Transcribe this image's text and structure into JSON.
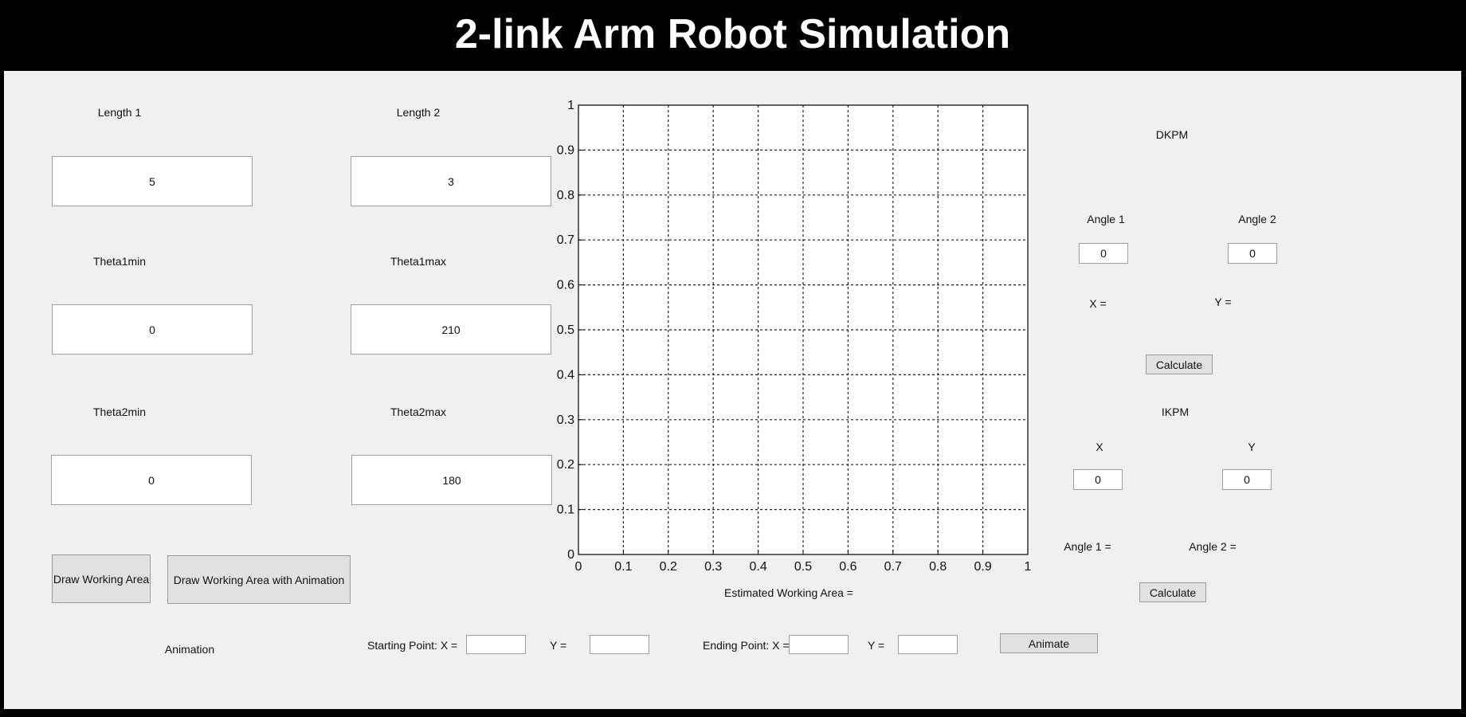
{
  "title": "2-link Arm Robot Simulation",
  "params": {
    "length1": {
      "label": "Length 1",
      "value": "5"
    },
    "length2": {
      "label": "Length 2",
      "value": "3"
    },
    "theta1min": {
      "label": "Theta1min",
      "value": "0"
    },
    "theta1max": {
      "label": "Theta1max",
      "value": "210"
    },
    "theta2min": {
      "label": "Theta2min",
      "value": "0"
    },
    "theta2max": {
      "label": "Theta2max",
      "value": "180"
    }
  },
  "buttons": {
    "draw": "Draw Working Area",
    "draw_anim": "Draw Working Area with Animation",
    "dkpm_calc": "Calculate",
    "ikpm_calc": "Calculate",
    "animate": "Animate"
  },
  "plot": {
    "estimated_label": "Estimated Working Area  =",
    "xlim": [
      0,
      1
    ],
    "ylim": [
      0,
      1
    ],
    "ticks": [
      "0",
      "0.1",
      "0.2",
      "0.3",
      "0.4",
      "0.5",
      "0.6",
      "0.7",
      "0.8",
      "0.9",
      "1"
    ],
    "grid": true
  },
  "dkpm": {
    "title": "DKPM",
    "angle1_label": "Angle 1",
    "angle2_label": "Angle 2",
    "angle1_value": "0",
    "angle2_value": "0",
    "x_result": "X =",
    "y_result": "Y ="
  },
  "ikpm": {
    "title": "IKPM",
    "x_label": "X",
    "y_label": "Y",
    "x_value": "0",
    "y_value": "0",
    "angle1_result": "Angle 1 =",
    "angle2_result": "Angle 2 ="
  },
  "animation": {
    "label": "Animation",
    "start_label": "Starting Point: X =",
    "start_y_label": "Y =",
    "end_label": "Ending Point: X =",
    "end_y_label": "Y =",
    "start_x": "",
    "start_y": "",
    "end_x": "",
    "end_y": ""
  }
}
